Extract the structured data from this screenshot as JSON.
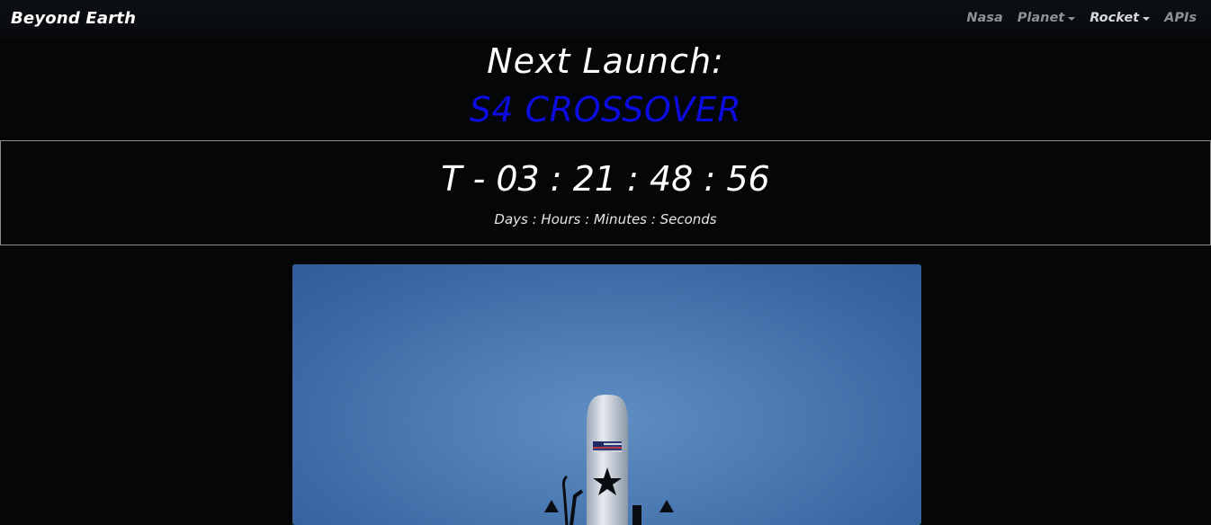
{
  "navbar": {
    "brand": "Beyond Earth",
    "items": [
      {
        "label": "Nasa",
        "dropdown": false,
        "active": false
      },
      {
        "label": "Planet",
        "dropdown": true,
        "active": false
      },
      {
        "label": "Rocket",
        "dropdown": true,
        "active": true
      },
      {
        "label": "APIs",
        "dropdown": false,
        "active": false
      }
    ]
  },
  "launch": {
    "heading": "Next Launch:",
    "mission": "S4 CROSSOVER",
    "countdown": "T - 03 : 21 : 48 : 56",
    "countdown_label": "Days : Hours : Minutes : Seconds"
  },
  "colors": {
    "background": "#050607",
    "mission_text": "#0c0ce0",
    "nav_text": "#8e9296",
    "sky": "#4c7bb3"
  },
  "image": {
    "icon": "rocket-photo"
  }
}
